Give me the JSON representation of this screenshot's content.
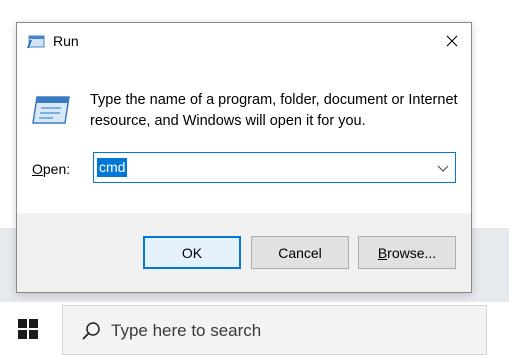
{
  "dialog": {
    "title": "Run",
    "description": "Type the name of a program, folder, document or Internet resource, and Windows will open it for you.",
    "open_label_accel": "O",
    "open_label_rest": "pen:",
    "open_value": "cmd",
    "ok_label": "OK",
    "cancel_label": "Cancel",
    "browse_label_accel": "B",
    "browse_label_rest": "rowse..."
  },
  "taskbar": {
    "search_placeholder": "Type here to search"
  },
  "icons": {
    "close": "close-icon",
    "title": "run-icon",
    "chevron": "chevron-down-icon",
    "start": "windows-logo-icon",
    "search": "search-icon"
  },
  "colors": {
    "accent": "#0078d7",
    "button_area": "#f0f0f0",
    "desktop": "#e6e9ee"
  }
}
